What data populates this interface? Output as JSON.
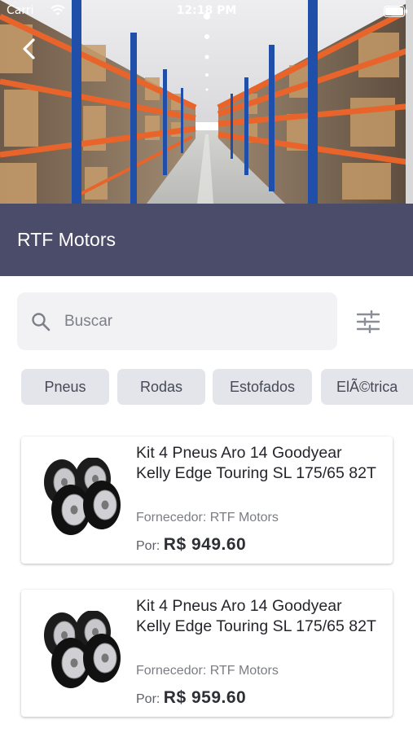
{
  "status_bar": {
    "carrier": "Carri",
    "time": "12:18 PM",
    "icons": [
      "wifi-icon",
      "battery-icon"
    ]
  },
  "header": {
    "back_icon": "chevron-left-icon",
    "store_name": "RTF Motors",
    "title_bar_color": "#4b4c69"
  },
  "search": {
    "placeholder": "Buscar",
    "value": "",
    "icon": "search-icon",
    "filter_icon": "sliders-icon"
  },
  "categories": [
    {
      "label": "Pneus"
    },
    {
      "label": "Rodas"
    },
    {
      "label": "Estofados"
    },
    {
      "label": "ElÃ©trica"
    }
  ],
  "products": [
    {
      "name": "Kit 4 Pneus Aro 14 Goodyear Kelly Edge Touring SL 175/65 82T",
      "supplier": "Fornecedor: RTF Motors",
      "price_label": "Por:",
      "price": "R$ 949.60",
      "image": "tires-icon"
    },
    {
      "name": "Kit 4 Pneus Aro 14 Goodyear Kelly Edge Touring SL 175/65 82T",
      "supplier": "Fornecedor: RTF Motors",
      "price_label": "Por:",
      "price": "R$ 959.60",
      "image": "tires-icon"
    }
  ],
  "colors": {
    "title_bar": "#4b4c69",
    "chip_bg": "#e3e5ea",
    "search_bg": "#f2f2f5",
    "shelf_orange": "#e8642a",
    "shelf_blue": "#1f4fa8"
  }
}
